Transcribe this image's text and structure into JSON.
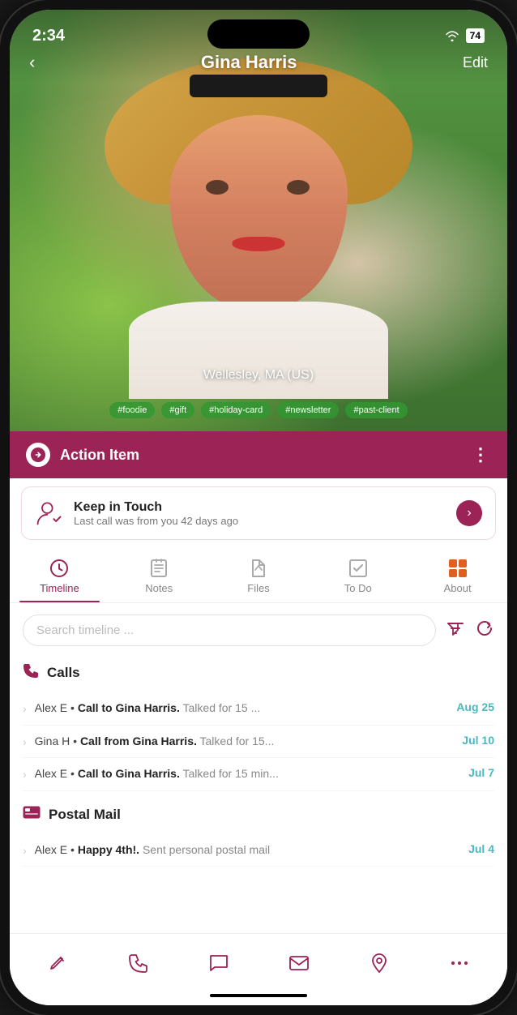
{
  "status": {
    "time": "2:34",
    "wifi": "wifi",
    "battery": "74"
  },
  "header": {
    "back_label": "‹",
    "contact_name": "Gina Harris",
    "edit_label": "Edit"
  },
  "profile": {
    "location": "Wellesley, MA (US)",
    "tags": [
      "#foodie",
      "#gift",
      "#holiday-card",
      "#newsletter",
      "#past-client"
    ]
  },
  "action_item": {
    "label": "Action Item",
    "dots": "⋮"
  },
  "keep_in_touch": {
    "title": "Keep in Touch",
    "subtitle": "Last call was from you 42 days ago"
  },
  "tabs": [
    {
      "id": "timeline",
      "label": "Timeline",
      "active": true
    },
    {
      "id": "notes",
      "label": "Notes",
      "active": false
    },
    {
      "id": "files",
      "label": "Files",
      "active": false
    },
    {
      "id": "todo",
      "label": "To Do",
      "active": false
    },
    {
      "id": "about",
      "label": "About",
      "active": false
    }
  ],
  "search": {
    "placeholder": "Search timeline ..."
  },
  "sections": {
    "calls": {
      "title": "Calls",
      "items": [
        {
          "person": "Alex E",
          "description": "Call to Gina Harris.",
          "detail": "Talked for 15 ...",
          "date": "Aug 25"
        },
        {
          "person": "Gina H",
          "description": "Call from Gina Harris.",
          "detail": "Talked for 15...",
          "date": "Jul 10"
        },
        {
          "person": "Alex E",
          "description": "Call to Gina Harris.",
          "detail": "Talked for 15 min...",
          "date": "Jul 7"
        }
      ]
    },
    "postal_mail": {
      "title": "Postal Mail",
      "items": [
        {
          "person": "Alex E",
          "description": "Happy 4th!.",
          "detail": "Sent personal postal mail",
          "date": "Jul 4"
        }
      ]
    }
  },
  "bottom_actions": [
    {
      "id": "edit",
      "label": "Edit"
    },
    {
      "id": "call",
      "label": "Call"
    },
    {
      "id": "message",
      "label": "Message"
    },
    {
      "id": "email",
      "label": "Email"
    },
    {
      "id": "location",
      "label": "Location"
    },
    {
      "id": "more",
      "label": "More"
    }
  ]
}
